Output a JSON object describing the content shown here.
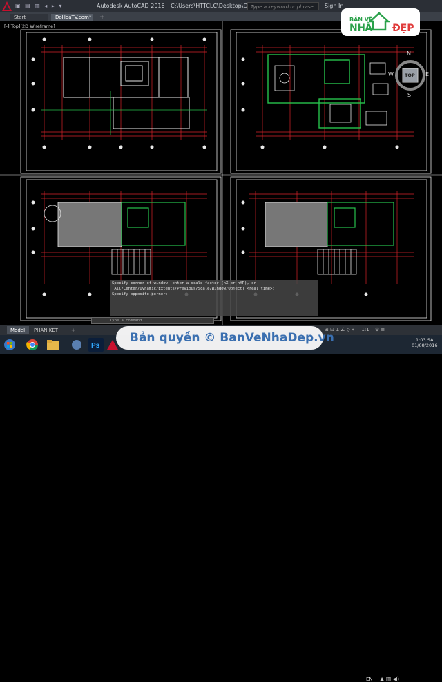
{
  "titlebar": {
    "app_title": "Autodesk AutoCAD 2016",
    "file_path": "C:\\Users\\HTTCLC\\Desktop\\DoHoaTV.com.dwg",
    "search_placeholder": "Type a keyword or phrase",
    "sign_in": "Sign In"
  },
  "tabs": {
    "start": "Start",
    "file": "DoHoaTV.com*",
    "add": "+"
  },
  "viewport": {
    "label": "[-][Top][2D Wireframe]"
  },
  "viewcube": {
    "north": "N",
    "south": "S",
    "west": "W",
    "east": "E",
    "top": "TOP"
  },
  "command": {
    "line1": "Specify corner of window, enter a scale factor (nX or nXP), or",
    "line2": "[All/Center/Dynamic/Extents/Previous/Scale/Window/Object] <real time>:",
    "line3": "Specify opposite corner:",
    "input_placeholder": "Type a command"
  },
  "layout_tabs": {
    "model": "Model",
    "layout": "PHAN KET CAU",
    "add": "+"
  },
  "status": {
    "scale": "1:1"
  },
  "taskbar": {
    "language": "EN",
    "time": "1:03 SA",
    "date": "01/08/2016"
  },
  "watermark": {
    "text": "Bản quyền © BanVeNhaDep.vn"
  },
  "brand_badge": {
    "line1": "BẢN VẼ",
    "line2": "NHÀ",
    "line3": "ĐẸP"
  },
  "colors": {
    "accent_green": "#2aa14a",
    "accent_red": "#e03a3a",
    "cad_red": "#d8232a",
    "cad_green": "#27c24c",
    "cad_white": "#e8e8e8"
  },
  "icons": [
    "autocad-logo-icon",
    "compass-icon",
    "close-icon",
    "plus-icon",
    "windows-start-icon",
    "chrome-icon",
    "photoshop-icon"
  ]
}
